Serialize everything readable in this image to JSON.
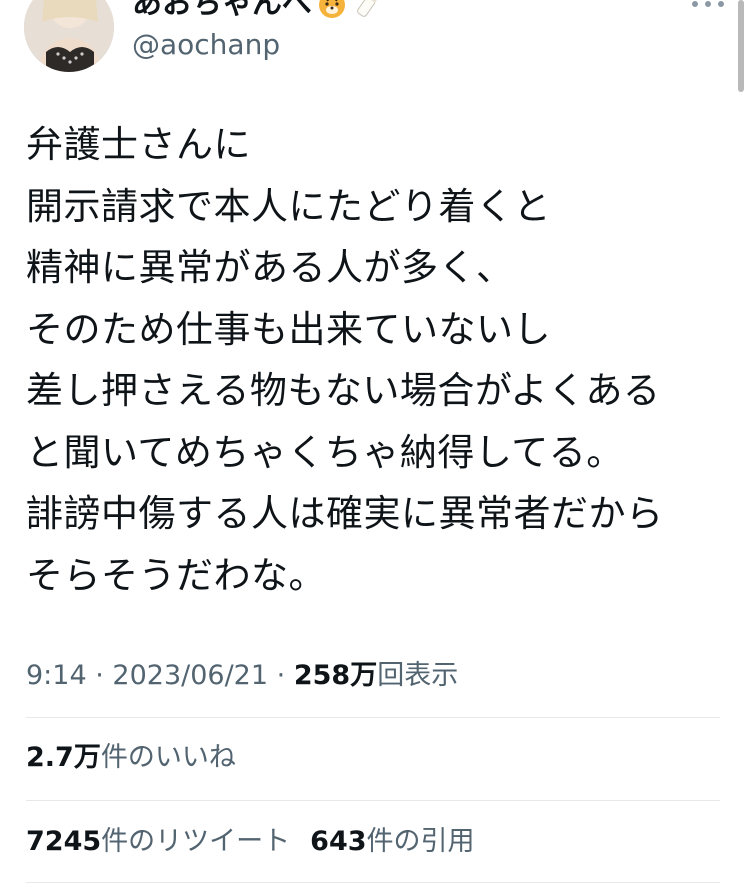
{
  "author": {
    "display_name": "あおちゃんぺ",
    "emoji_icons": [
      "tiger-face-icon",
      "baby-bottle-icon"
    ],
    "handle": "@aochanp"
  },
  "tweet": {
    "lines": [
      "弁護士さんに",
      "開示請求で本人にたどり着くと",
      "精神に異常がある人が多く、",
      "そのため仕事も出来ていないし",
      "差し押さえる物もない場合がよくある",
      "と聞いてめちゃくちゃ納得してる。",
      "誹謗中傷する人は確実に異常者だから",
      "そらそうだわな。"
    ]
  },
  "meta": {
    "time": "9:14",
    "separator": "·",
    "date": "2023/06/21",
    "views_count": "258万",
    "views_label": "回表示"
  },
  "stats": {
    "likes_count": "2.7万",
    "likes_label": "件のいいね",
    "retweets_count": "7245",
    "retweets_label": "件のリツイート",
    "quotes_count": "643",
    "quotes_label": "件の引用"
  },
  "colors": {
    "text_primary": "#0f1419",
    "text_secondary": "#536471",
    "divider": "#e6e9eb"
  }
}
